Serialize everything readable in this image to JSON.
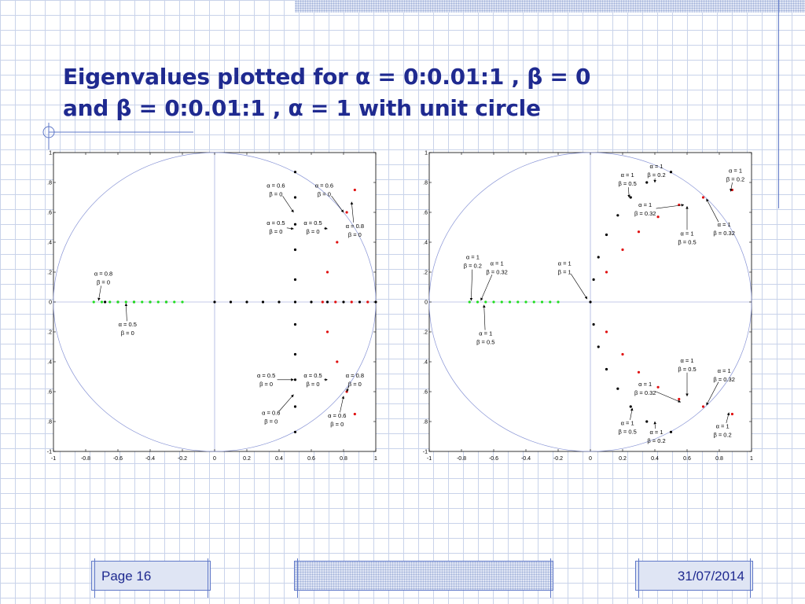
{
  "slide": {
    "title_line1": "Eigenvalues  plotted  for α = 0:0.01:1 , β = 0",
    "title_line2": "and β = 0:0.01:1 , α = 1 with unit circle",
    "page_label": "Page 16",
    "date": "31/07/2014"
  },
  "colors": {
    "title": "#1f2a90",
    "grid": "#c9d3ea",
    "circle": "#8a96d6",
    "black_series": "#000000",
    "red_series": "#e01010",
    "green_series": "#22dd22"
  },
  "chart_data": [
    {
      "type": "scatter",
      "title": "",
      "xlabel": "",
      "ylabel": "",
      "xlim": [
        -1,
        1
      ],
      "ylim": [
        -1,
        1
      ],
      "xticks": [
        "-1",
        "-0.8",
        "-0.6",
        "-0.4",
        "-0.2",
        "0",
        "0.2",
        "0.4",
        "0.6",
        "0.8",
        "1"
      ],
      "yticks": [
        "-1",
        "-0.8",
        "-0.6",
        "-0.4",
        "-0.2",
        "0",
        "0.2",
        "0.4",
        "0.6",
        "0.8",
        "1"
      ],
      "unit_circle": true,
      "series": [
        {
          "color": "black",
          "points": [
            [
              -0.68,
              0
            ],
            [
              -0.6,
              0
            ],
            [
              -0.5,
              0
            ],
            [
              -0.4,
              0
            ],
            [
              -0.3,
              0
            ],
            [
              0,
              0
            ],
            [
              0.1,
              0
            ],
            [
              0.2,
              0
            ],
            [
              0.3,
              0
            ],
            [
              0.4,
              0
            ],
            [
              0.5,
              0
            ],
            [
              0.6,
              0
            ],
            [
              0.7,
              0
            ],
            [
              0.8,
              0
            ],
            [
              0.9,
              0
            ],
            [
              1,
              0
            ],
            [
              0.5,
              0.87
            ],
            [
              0.5,
              0.7
            ],
            [
              0.5,
              0.52
            ],
            [
              0.5,
              0.35
            ],
            [
              0.5,
              0.15
            ],
            [
              0.5,
              -0.15
            ],
            [
              0.5,
              -0.35
            ],
            [
              0.5,
              -0.52
            ],
            [
              0.5,
              -0.7
            ],
            [
              0.5,
              -0.87
            ]
          ]
        },
        {
          "color": "red",
          "points": [
            [
              0.67,
              0
            ],
            [
              0.7,
              0.2
            ],
            [
              0.76,
              0.4
            ],
            [
              0.82,
              0.6
            ],
            [
              0.87,
              0.75
            ],
            [
              0.7,
              -0.2
            ],
            [
              0.76,
              -0.4
            ],
            [
              0.82,
              -0.6
            ],
            [
              0.87,
              -0.75
            ],
            [
              0.75,
              0
            ],
            [
              0.85,
              0
            ],
            [
              0.95,
              0
            ]
          ]
        },
        {
          "color": "green",
          "points": [
            [
              -0.75,
              0
            ],
            [
              -0.7,
              0
            ],
            [
              -0.65,
              0
            ],
            [
              -0.6,
              0
            ],
            [
              -0.55,
              0
            ],
            [
              -0.5,
              0
            ],
            [
              -0.45,
              0
            ],
            [
              -0.4,
              0
            ],
            [
              -0.35,
              0
            ],
            [
              -0.3,
              0
            ],
            [
              -0.25,
              0
            ],
            [
              -0.2,
              0
            ]
          ]
        }
      ],
      "annotations": [
        {
          "line1": "α = 0.6",
          "line2": "β = 0",
          "x": 0.38,
          "y": 0.75,
          "ax": 0.49,
          "ay": 0.6
        },
        {
          "line1": "α = 0.6",
          "line2": "β = 0",
          "x": 0.68,
          "y": 0.75,
          "ax": 0.8,
          "ay": 0.6
        },
        {
          "line1": "α = 0.5",
          "line2": "β = 0",
          "x": 0.38,
          "y": 0.5,
          "ax": 0.49,
          "ay": 0.49
        },
        {
          "line1": "α = 0.5",
          "line2": "β = 0",
          "x": 0.61,
          "y": 0.5,
          "ax": 0.7,
          "ay": 0.49
        },
        {
          "line1": "α = 0.8",
          "line2": "β = 0",
          "x": 0.87,
          "y": 0.48,
          "ax": 0.85,
          "ay": 0.67
        },
        {
          "line1": "α = 0.8",
          "line2": "β = 0",
          "x": -0.69,
          "y": 0.16,
          "ax": -0.72,
          "ay": 0.01
        },
        {
          "line1": "α = 0.5",
          "line2": "β = 0",
          "x": -0.54,
          "y": -0.18,
          "ax": -0.55,
          "ay": -0.01
        },
        {
          "line1": "α = 0.5",
          "line2": "β = 0",
          "x": 0.32,
          "y": -0.52,
          "ax": 0.49,
          "ay": -0.52
        },
        {
          "line1": "α = 0.5",
          "line2": "β = 0",
          "x": 0.61,
          "y": -0.52,
          "ax": 0.7,
          "ay": -0.52
        },
        {
          "line1": "α = 0.8",
          "line2": "β = 0",
          "x": 0.87,
          "y": -0.52,
          "ax": 0.82,
          "ay": -0.6
        },
        {
          "line1": "α = 0.6",
          "line2": "β = 0",
          "x": 0.35,
          "y": -0.77,
          "ax": 0.49,
          "ay": -0.62
        },
        {
          "line1": "α = 0.6",
          "line2": "β = 0",
          "x": 0.76,
          "y": -0.79,
          "ax": 0.8,
          "ay": -0.63
        }
      ]
    },
    {
      "type": "scatter",
      "title": "",
      "xlabel": "",
      "ylabel": "",
      "xlim": [
        -1,
        1
      ],
      "ylim": [
        -1,
        1
      ],
      "xticks": [
        "-1",
        "-0.8",
        "-0.6",
        "-0.4",
        "-0.2",
        "0",
        "0.2",
        "0.4",
        "0.6",
        "0.8",
        "1"
      ],
      "yticks": [
        "-1",
        "-0.8",
        "-0.6",
        "-0.4",
        "-0.2",
        "0",
        "0.2",
        "0.4",
        "0.6",
        "0.8",
        "1"
      ],
      "unit_circle": true,
      "series": [
        {
          "color": "black",
          "points": [
            [
              0,
              0
            ],
            [
              0.02,
              0.15
            ],
            [
              0.05,
              0.3
            ],
            [
              0.1,
              0.45
            ],
            [
              0.17,
              0.58
            ],
            [
              0.25,
              0.7
            ],
            [
              0.35,
              0.8
            ],
            [
              0.5,
              0.87
            ],
            [
              0.02,
              -0.15
            ],
            [
              0.05,
              -0.3
            ],
            [
              0.1,
              -0.45
            ],
            [
              0.17,
              -0.58
            ],
            [
              0.25,
              -0.7
            ],
            [
              0.35,
              -0.8
            ],
            [
              0.5,
              -0.87
            ]
          ]
        },
        {
          "color": "red",
          "points": [
            [
              0.1,
              0.2
            ],
            [
              0.2,
              0.35
            ],
            [
              0.3,
              0.47
            ],
            [
              0.42,
              0.57
            ],
            [
              0.55,
              0.65
            ],
            [
              0.7,
              0.7
            ],
            [
              0.88,
              0.75
            ],
            [
              0.1,
              -0.2
            ],
            [
              0.2,
              -0.35
            ],
            [
              0.3,
              -0.47
            ],
            [
              0.42,
              -0.57
            ],
            [
              0.55,
              -0.65
            ],
            [
              0.7,
              -0.7
            ],
            [
              0.88,
              -0.75
            ]
          ]
        },
        {
          "color": "green",
          "points": [
            [
              -0.75,
              0
            ],
            [
              -0.7,
              0
            ],
            [
              -0.65,
              0
            ],
            [
              -0.6,
              0
            ],
            [
              -0.55,
              0
            ],
            [
              -0.5,
              0
            ],
            [
              -0.45,
              0
            ],
            [
              -0.4,
              0
            ],
            [
              -0.35,
              0
            ],
            [
              -0.3,
              0
            ],
            [
              -0.25,
              0
            ],
            [
              -0.2,
              0
            ]
          ]
        }
      ],
      "annotations": [
        {
          "line1": "α = 1",
          "line2": "β = 0.2",
          "x": 0.41,
          "y": 0.88,
          "ax": 0.4,
          "ay": 0.8
        },
        {
          "line1": "α = 1",
          "line2": "β = 0.5",
          "x": 0.23,
          "y": 0.82,
          "ax": 0.24,
          "ay": 0.7
        },
        {
          "line1": "α = 1",
          "line2": "β = 0.32",
          "x": 0.34,
          "y": 0.62,
          "ax": 0.58,
          "ay": 0.65
        },
        {
          "line1": "α = 1",
          "line2": "β = 0.2",
          "x": 0.9,
          "y": 0.85,
          "ax": 0.87,
          "ay": 0.74
        },
        {
          "line1": "α = 1",
          "line2": "β = 0.32",
          "x": 0.83,
          "y": 0.49,
          "ax": 0.72,
          "ay": 0.69
        },
        {
          "line1": "α = 1",
          "line2": "β = 0.5",
          "x": 0.6,
          "y": 0.43,
          "ax": 0.6,
          "ay": 0.64
        },
        {
          "line1": "α = 1",
          "line2": "β = 0.2",
          "x": -0.73,
          "y": 0.27,
          "ax": -0.74,
          "ay": 0.01
        },
        {
          "line1": "α = 1",
          "line2": "β = 0.32",
          "x": -0.58,
          "y": 0.23,
          "ax": -0.68,
          "ay": 0.01
        },
        {
          "line1": "α = 1",
          "line2": "β = 1",
          "x": -0.16,
          "y": 0.23,
          "ax": -0.02,
          "ay": 0.02
        },
        {
          "line1": "α = 1",
          "line2": "β = 0.5",
          "x": -0.65,
          "y": -0.24,
          "ax": -0.66,
          "ay": -0.02
        },
        {
          "line1": "α = 1",
          "line2": "β = 0.5",
          "x": 0.6,
          "y": -0.42,
          "ax": 0.6,
          "ay": -0.63
        },
        {
          "line1": "α = 1",
          "line2": "β = 0.32",
          "x": 0.83,
          "y": -0.49,
          "ax": 0.72,
          "ay": -0.69
        },
        {
          "line1": "α = 1",
          "line2": "β = 0.32",
          "x": 0.34,
          "y": -0.58,
          "ax": 0.56,
          "ay": -0.67
        },
        {
          "line1": "α = 1",
          "line2": "β = 0.5",
          "x": 0.23,
          "y": -0.84,
          "ax": 0.26,
          "ay": -0.71
        },
        {
          "line1": "α = 1",
          "line2": "β = 0.2",
          "x": 0.41,
          "y": -0.9,
          "ax": 0.4,
          "ay": -0.8
        },
        {
          "line1": "α = 1",
          "line2": "β = 0.2",
          "x": 0.82,
          "y": -0.86,
          "ax": 0.86,
          "ay": -0.74
        }
      ]
    }
  ]
}
